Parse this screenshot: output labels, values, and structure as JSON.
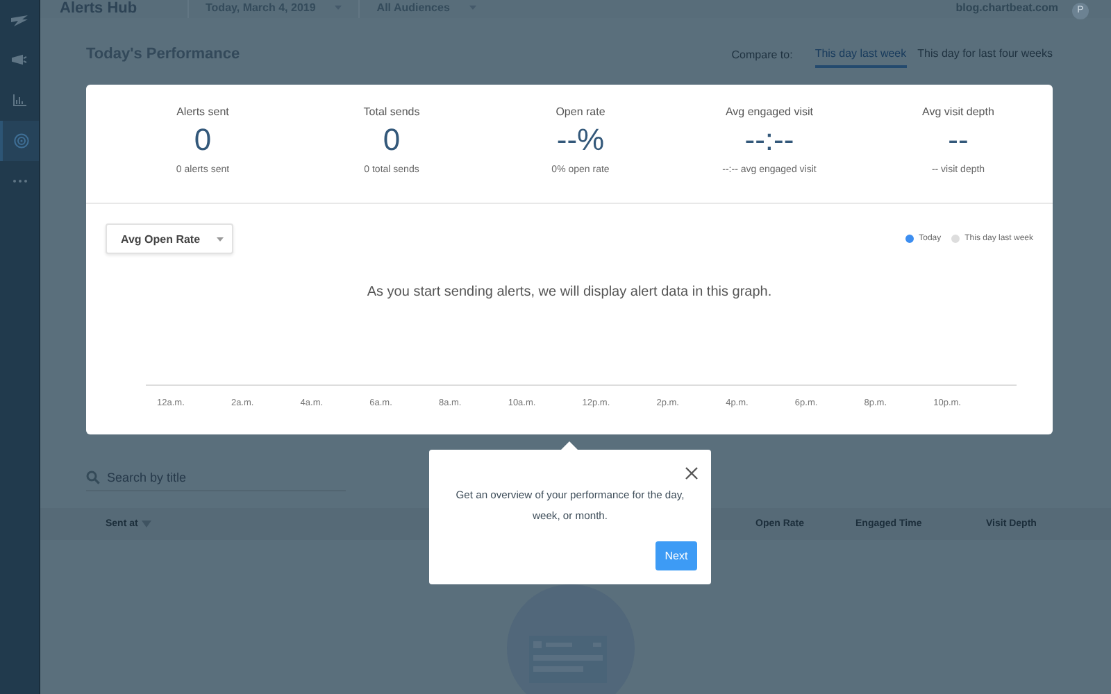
{
  "header": {
    "title": "Alerts Hub",
    "date_filter": "Today, March 4, 2019",
    "audience_filter": "All Audiences",
    "site": "blog.chartbeat.com",
    "avatar": "P"
  },
  "sidebar": {
    "items": [
      {
        "selected": false
      },
      {
        "selected": false
      },
      {
        "selected": false
      },
      {
        "selected": true
      },
      {
        "selected": false
      }
    ]
  },
  "performance": {
    "title": "Today's Performance",
    "compare_label": "Compare to:",
    "compare_tabs": [
      {
        "label": "This day last week",
        "selected": true
      },
      {
        "label": "This day for last four weeks",
        "selected": false
      }
    ],
    "stats": [
      {
        "label": "Alerts sent",
        "value": "0",
        "detail": "0 alerts sent"
      },
      {
        "label": "Total sends",
        "value": "0",
        "detail": "0 total sends"
      },
      {
        "label": "Open rate",
        "value": "--%",
        "detail": "0% open rate"
      },
      {
        "label": "Avg engaged visit",
        "value": "--:--",
        "detail": "--:-- avg engaged visit"
      },
      {
        "label": "Avg visit depth",
        "value": "--",
        "detail": "-- visit depth"
      }
    ],
    "metric_dropdown": "Avg Open Rate",
    "legend": [
      {
        "label": "Today",
        "color": "#3d8ef0"
      },
      {
        "label": "This day last week",
        "color": "#dddddd"
      }
    ],
    "empty_message": "As you start sending alerts, we will display alert data in this graph.",
    "axis_labels": [
      "12a.m.",
      "2a.m.",
      "4a.m.",
      "6a.m.",
      "8a.m.",
      "10a.m.",
      "12p.m.",
      "2p.m.",
      "4p.m.",
      "6p.m.",
      "8p.m.",
      "10p.m."
    ]
  },
  "search": {
    "placeholder": "Search by title"
  },
  "table": {
    "columns": [
      {
        "label": "Sent at",
        "sorted": true
      },
      {
        "label": "Open Rate",
        "sorted": false
      },
      {
        "label": "Engaged Time",
        "sorted": false
      },
      {
        "label": "Visit Depth",
        "sorted": false
      }
    ]
  },
  "tour_popover": {
    "text": "Get an overview of your performance for the day, week, or month.",
    "button": "Next"
  }
}
